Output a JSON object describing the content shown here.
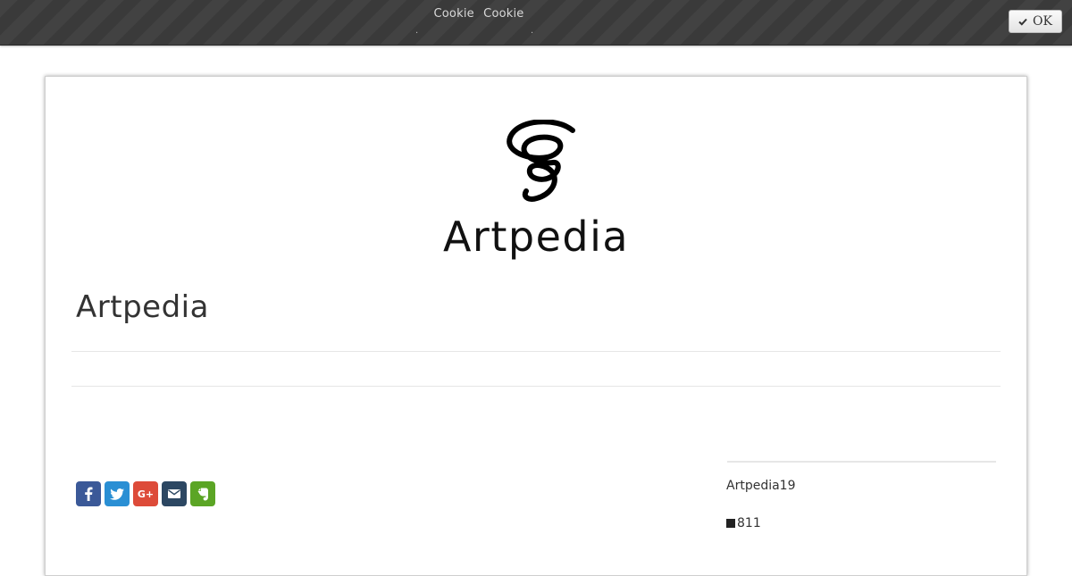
{
  "cookie_bar": {
    "text_1": "Cookie",
    "text_2": "Cookie",
    "ok_label": "OK",
    "ok_icon": "checkmark-icon"
  },
  "header": {
    "logo_icon": "tornado-swirl-logo",
    "logo_text": "Artpedia"
  },
  "main": {
    "title": "Artpedia"
  },
  "share": {
    "buttons": [
      {
        "name": "facebook",
        "icon": "facebook-icon",
        "color": "#3b5998"
      },
      {
        "name": "twitter",
        "icon": "twitter-icon",
        "color": "#2a8fd4"
      },
      {
        "name": "google-plus",
        "icon": "google-plus-icon",
        "color": "#dd4b39"
      },
      {
        "name": "email",
        "icon": "email-icon",
        "color": "#2c4762"
      },
      {
        "name": "evernote",
        "icon": "evernote-icon",
        "color": "#5ba525"
      }
    ],
    "gplus_glyph": "G+"
  },
  "sidebar": {
    "line_1": "Artpedia19",
    "line_2": "811",
    "line_2_icon": "square-icon"
  }
}
